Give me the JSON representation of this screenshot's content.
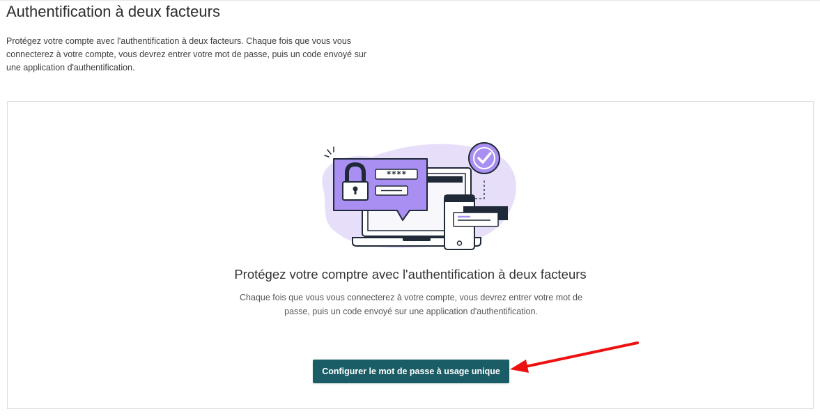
{
  "header": {
    "title": "Authentification à deux facteurs",
    "description": "Protégez votre compte avec l'authentification à deux facteurs. Chaque fois que vous vous connecterez à votre compte, vous devrez entrer votre mot de passe, puis un code envoyé sur une application d'authentification."
  },
  "card": {
    "illustration": {
      "name": "two-factor-illustration",
      "password_mask": "****",
      "colors": {
        "blob": "#e7dffa",
        "accent": "#a98ff2",
        "outline": "#1f2937"
      }
    },
    "title": "Protégez votre comptre avec l'authentification à deux facteurs",
    "description": "Chaque fois que vous vous connecterez à votre compte, vous devrez entrer votre mot de passe, puis un code envoyé sur une application d'authentification.",
    "button_label": "Configurer le mot de passe à usage unique"
  },
  "annotation": {
    "type": "arrow",
    "color": "#ee1111"
  },
  "colors": {
    "button_bg": "#1b5d66",
    "button_text": "#ffffff",
    "card_border": "#dcdcdc"
  }
}
